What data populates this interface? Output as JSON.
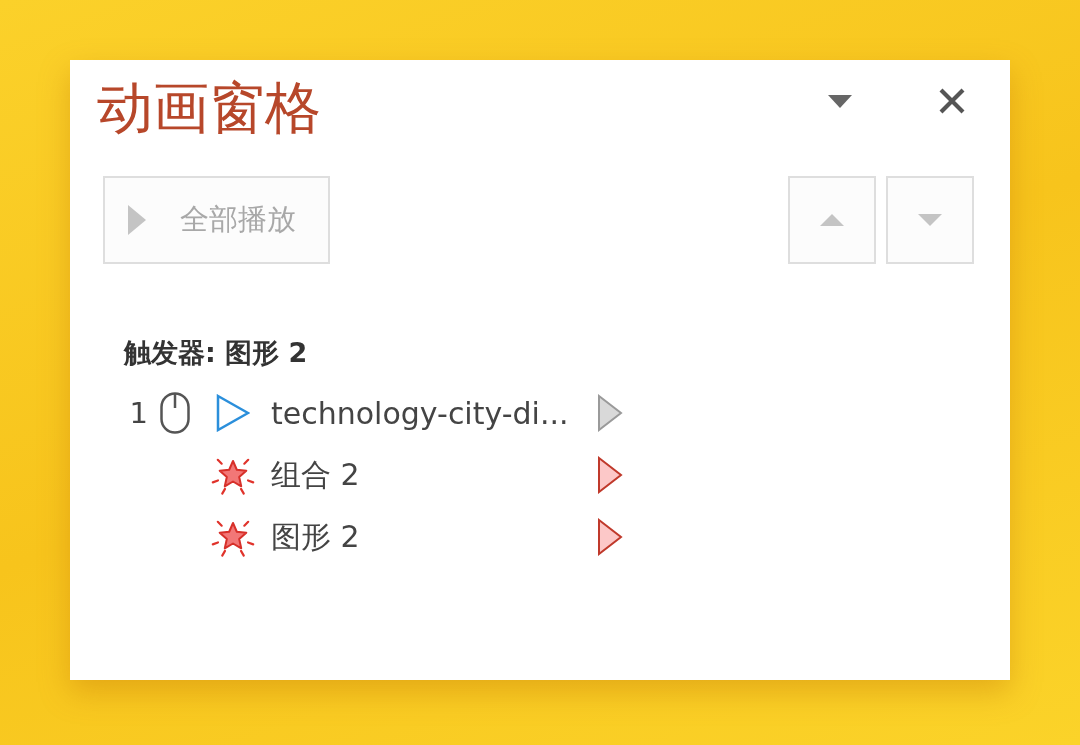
{
  "panel": {
    "title": "动画窗格"
  },
  "toolbar": {
    "play_all": {
      "label": "全部播放",
      "disabled": true
    },
    "move_up": {
      "disabled": true
    },
    "move_down": {
      "disabled": true
    }
  },
  "trigger": "触发器: 图形 2",
  "animations": [
    {
      "order": "1",
      "on_click": true,
      "kind": "entrance",
      "name": "technology-city-di..."
    },
    {
      "on_click": false,
      "kind": "emphasis",
      "name": "组合 2"
    },
    {
      "on_click": false,
      "kind": "emphasis",
      "name": "图形 2"
    }
  ]
}
